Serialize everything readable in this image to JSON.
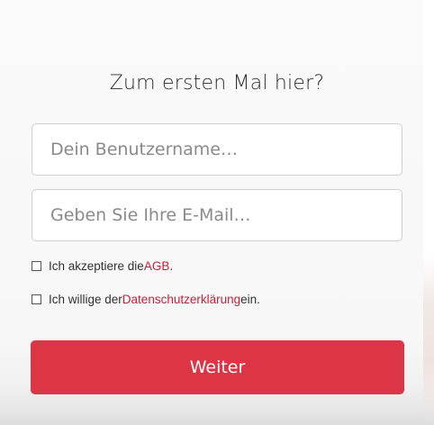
{
  "form": {
    "title": "Zum ersten Mal hier?",
    "username_placeholder": "Dein Benutzername…",
    "email_placeholder": "Geben Sie Ihre E-Mail…",
    "agb_prefix": "Ich akzeptiere die ",
    "agb_link": "AGB",
    "agb_suffix": ".",
    "privacy_prefix": "Ich willige der ",
    "privacy_link": "Datenschutzerklärung",
    "privacy_suffix": " ein.",
    "submit_label": "Weiter"
  },
  "colors": {
    "accent": "#dc3545",
    "link": "#c4223a"
  }
}
